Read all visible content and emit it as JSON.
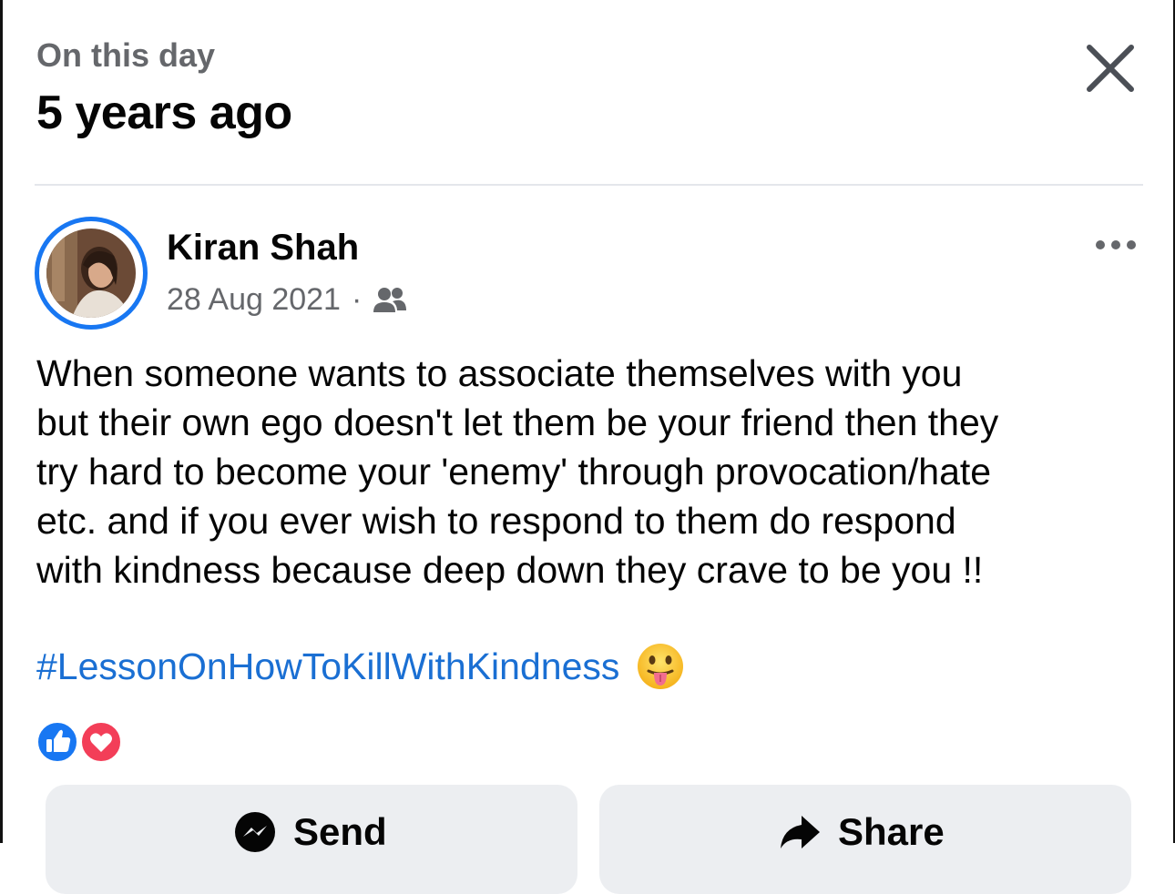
{
  "header": {
    "subtitle": "On this day",
    "title": "5 years ago"
  },
  "post": {
    "author": "Kiran Shah",
    "date": "28 Aug 2021",
    "separator": "·",
    "audience_icon": "friends-icon",
    "text": "When someone wants to associate themselves with you\nbut their own ego doesn't let them be your friend then they\ntry hard to become your 'enemy' through provocation/hate\netc. and if you ever wish to respond to them do respond\nwith kindness because deep down they crave to be you !!",
    "hashtag": "#LessonOnHowToKillWithKindness",
    "emoji": "tongue-out-emoji",
    "reactions": [
      "like",
      "love"
    ]
  },
  "actions": {
    "send_label": "Send",
    "share_label": "Share"
  },
  "colors": {
    "accent": "#1877f2",
    "hashtag": "#1a6fd3",
    "secondary_text": "#65676b",
    "button_bg": "#eceef1",
    "love": "#f33e58"
  }
}
